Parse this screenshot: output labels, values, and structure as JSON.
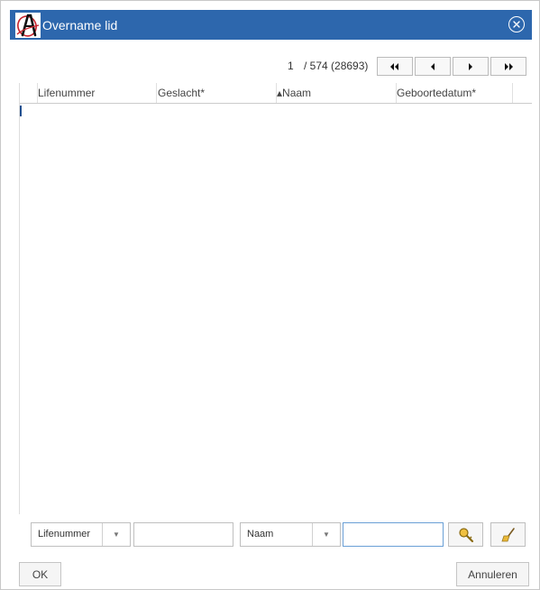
{
  "dialog": {
    "title": "Overname lid",
    "logo_icon": "app-logo-icon",
    "close_icon": "close-circle-icon"
  },
  "pager": {
    "current_page": "1",
    "total": "/ 574 (28693)",
    "buttons": [
      "first-page",
      "previous-page",
      "next-page",
      "last-page"
    ]
  },
  "grid": {
    "columns": [
      {
        "label": "Lifenummer"
      },
      {
        "label": "Geslacht*"
      },
      {
        "label": "▴Naam"
      },
      {
        "label": "Geboortedatum*"
      }
    ],
    "rows": []
  },
  "filters": {
    "field1": {
      "selected": "Lifenummer"
    },
    "value1": {
      "value": "",
      "placeholder": ""
    },
    "field2": {
      "selected": "Naam"
    },
    "value2": {
      "value": "",
      "placeholder": ""
    },
    "search_icon": "search-key-icon",
    "clear_icon": "broom-icon"
  },
  "footer": {
    "ok_label": "OK",
    "cancel_label": "Annuleren"
  },
  "colors": {
    "titlebar": "#2d67ad",
    "accent": "#1f4f8f"
  }
}
